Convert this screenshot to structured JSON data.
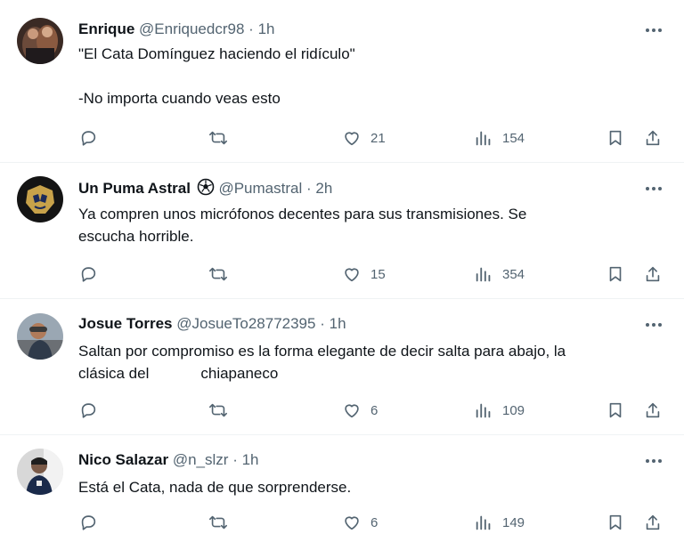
{
  "tweets": [
    {
      "name": "Enrique",
      "handle": "@Enriquedcr98",
      "separator": "·",
      "time": "1h",
      "lines": [
        "\"El Cata Domínguez haciendo el ridículo\"",
        "",
        "-No importa cuando veas esto"
      ],
      "likes": "21",
      "views": "154"
    },
    {
      "name": "Un Puma Astral",
      "handle": "@Pumastral",
      "separator": "·",
      "time": "2h",
      "lines": [
        "Ya compren unos micrófonos decentes para sus transmisiones. Se",
        "escucha horrible."
      ],
      "likes": "15",
      "views": "354"
    },
    {
      "name": "Josue Torres",
      "handle": "@JosueTo28772395",
      "separator": "·",
      "time": "1h",
      "lines": [
        "Saltan por compromiso es la forma elegante de decir salta para abajo, la",
        "clásica del",
        "chiapaneco"
      ],
      "likes": "6",
      "views": "109"
    },
    {
      "name": "Nico Salazar",
      "handle": "@n_slzr",
      "separator": "·",
      "time": "1h",
      "lines": [
        "Está el Cata, nada de que sorprenderse."
      ],
      "likes": "6",
      "views": "149"
    }
  ],
  "icons": {
    "more": "more-horizontal-icon",
    "reply": "reply-icon",
    "retweet": "retweet-icon",
    "like": "heart-icon",
    "views": "analytics-icon",
    "bookmark": "bookmark-icon",
    "share": "share-icon",
    "badge": "soccer-ball-icon"
  },
  "colors": {
    "text": "#0f1419",
    "secondary": "#536471",
    "divider": "#eff3f4",
    "background": "#ffffff"
  }
}
